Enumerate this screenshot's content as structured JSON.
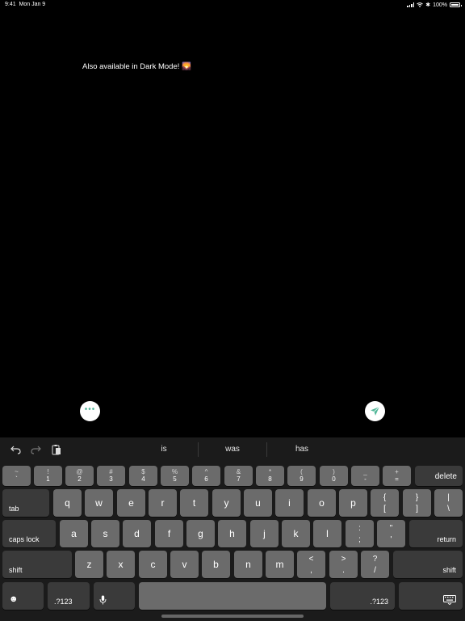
{
  "status_bar": {
    "time": "9:41",
    "date": "Mon Jan 9",
    "battery_percent": "100%"
  },
  "message": {
    "text": "Also available in Dark Mode! 🌄"
  },
  "suggestions": [
    "is",
    "was",
    "has"
  ],
  "keyboard": {
    "number_row": [
      {
        "top": "~",
        "bot": "`"
      },
      {
        "top": "!",
        "bot": "1"
      },
      {
        "top": "@",
        "bot": "2"
      },
      {
        "top": "#",
        "bot": "3"
      },
      {
        "top": "$",
        "bot": "4"
      },
      {
        "top": "%",
        "bot": "5"
      },
      {
        "top": "^",
        "bot": "6"
      },
      {
        "top": "&",
        "bot": "7"
      },
      {
        "top": "*",
        "bot": "8"
      },
      {
        "top": "(",
        "bot": "9"
      },
      {
        "top": ")",
        "bot": "0"
      },
      {
        "top": "_",
        "bot": "-"
      },
      {
        "top": "+",
        "bot": "="
      }
    ],
    "delete_label": "delete",
    "tab_label": "tab",
    "row_q": [
      "q",
      "w",
      "e",
      "r",
      "t",
      "y",
      "u",
      "i",
      "o",
      "p"
    ],
    "row_q_punct": [
      {
        "top": "{",
        "bot": "["
      },
      {
        "top": "}",
        "bot": "]"
      },
      {
        "top": "|",
        "bot": "\\"
      }
    ],
    "caps_label": "caps lock",
    "row_a": [
      "a",
      "s",
      "d",
      "f",
      "g",
      "h",
      "j",
      "k",
      "l"
    ],
    "row_a_punct": [
      {
        "top": ":",
        "bot": ";"
      },
      {
        "top": "\"",
        "bot": "'"
      }
    ],
    "return_label": "return",
    "shift_label": "shift",
    "row_z": [
      "z",
      "x",
      "c",
      "v",
      "b",
      "n",
      "m"
    ],
    "row_z_punct": [
      {
        "top": "<",
        "bot": ","
      },
      {
        "top": ">",
        "bot": "."
      },
      {
        "top": "?",
        "bot": "/"
      }
    ],
    "numbers_label": ".?123"
  }
}
